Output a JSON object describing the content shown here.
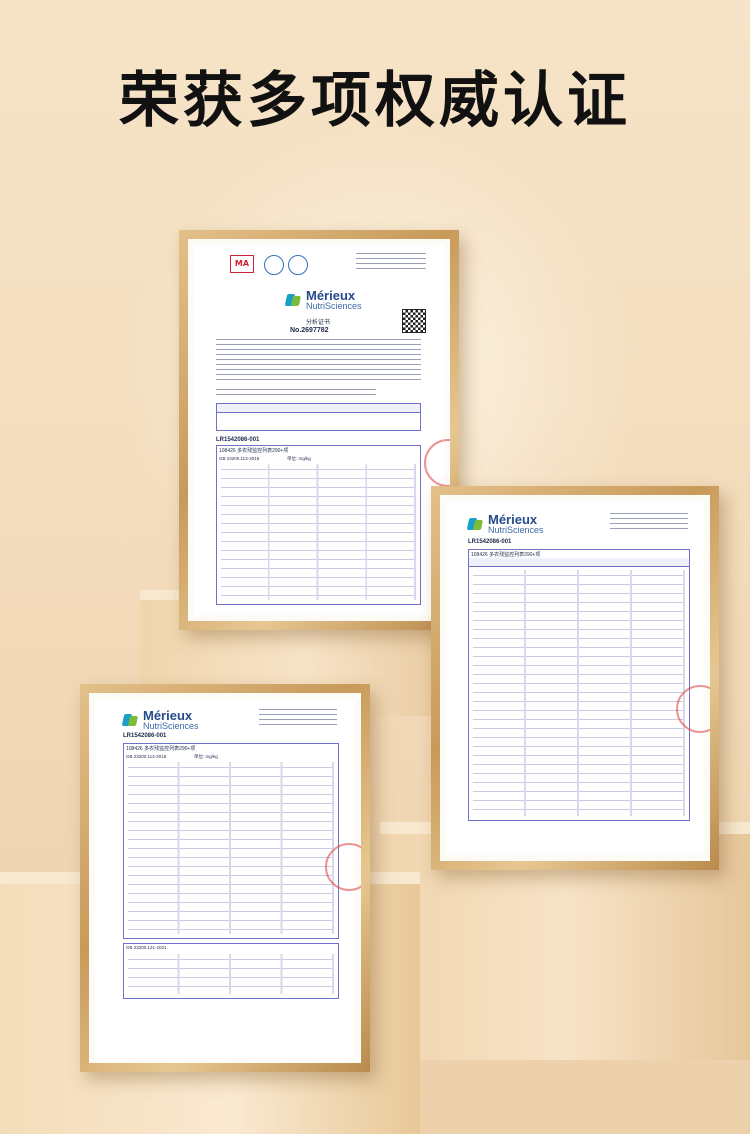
{
  "header": {
    "title": "荣获多项权威认证"
  },
  "certificates": [
    {
      "brand_main": "Mérieux",
      "brand_sub": "NutriSciences",
      "doc_title": "分析证书",
      "doc_no": "No.2697782",
      "sample_id": "LR1542086-001",
      "test_package": "108426 多农残监控列表290+项",
      "standard": "GB 23200.113-2018",
      "unit": "单位: mg/kg"
    },
    {
      "brand_main": "Mérieux",
      "brand_sub": "NutriSciences",
      "sample_id": "LR1542086-001",
      "test_package": "108426 多农残监控列表290+项"
    },
    {
      "brand_main": "Mérieux",
      "brand_sub": "NutriSciences",
      "sample_id": "LR1542086-001",
      "test_package": "108426 多农残监控列表290+项",
      "standard": "GB 23200.113-2018",
      "unit": "单位: mg/kg",
      "standard2": "GB 23200.121-2021"
    }
  ],
  "colors": {
    "accent": "#244c8c",
    "table_line": "#6f72c8",
    "frame": "#c89a5a"
  }
}
